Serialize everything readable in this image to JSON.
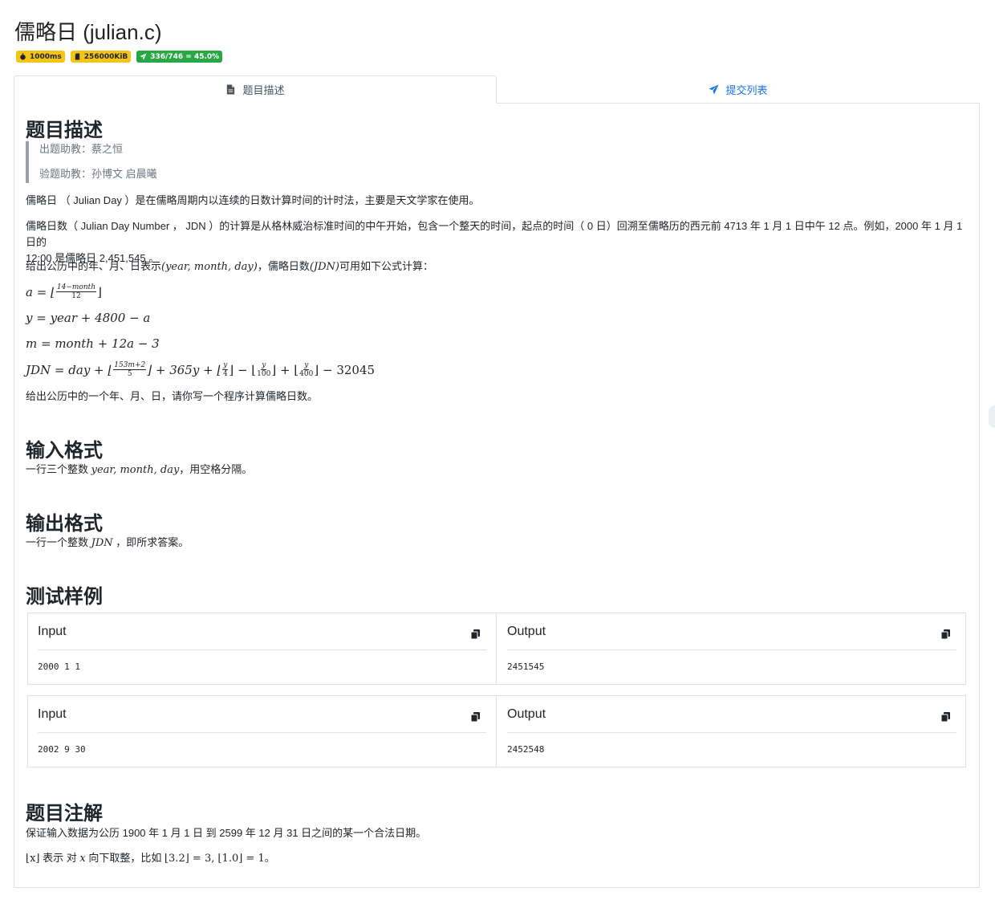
{
  "page": {
    "title": "儒略日 (julian.c)",
    "badges": [
      {
        "icon": "stopwatch-icon",
        "label": "1000ms",
        "color": "#f5c516"
      },
      {
        "icon": "sd-card-icon",
        "label": "256000KiB",
        "color": "#f5c516"
      },
      {
        "icon": "paper-plane-icon",
        "label": "336/746 = 45.0%",
        "color": "#28a745"
      }
    ]
  },
  "tabs": {
    "description": {
      "icon": "file-icon",
      "label": "题目描述"
    },
    "submissions": {
      "icon": "paper-plane-icon",
      "label": "提交列表"
    }
  },
  "problem": {
    "heading": "题目描述",
    "setter": "出题助教：蔡之恒",
    "tester": "验题助教：孙博文 启晨曦",
    "para1": "儒略日 （ Julian Day ）是在儒略周期内以连续的日数计算时间的计时法，主要是天文学家在使用。",
    "para2_line1": "儒略日数（ Julian Day Number ， JDN ）的计算是从格林威治标准时间的中午开始，包含一个整天的时间，起点的时间（ 0 日）回溯至儒略历的西元前 4713 年 1 月 1 日中午 12 点。例如，2000 年 1 月 1 日的",
    "para2_line2": "12:00 是儒略日 2,451,545 。",
    "para3_a": "给出公历中的年、月、日表示",
    "para3_math1": "(year, month, day)",
    "para3_b": "，儒略日数",
    "para3_math2": "(JDN)",
    "para3_c": "可用如下公式计算：",
    "para4": "给出公历中的一个年、月、日，请你写一个程序计算儒略日数。"
  },
  "formulas": {
    "f1_lhs": "a = ⌊",
    "f1_num": "14−month",
    "f1_den": "12",
    "f1_rhs": "⌋",
    "f2": "y = year + 4800 − a",
    "f3": "m = month + 12a − 3",
    "f4_a": "JDN = day + ⌊",
    "f4_num1": "153m+2",
    "f4_den1": "5",
    "f4_b": "⌋ + 365y + ⌊",
    "f4_num2": "y",
    "f4_den2": "4",
    "f4_c": "⌋ − ⌊",
    "f4_num3": "y",
    "f4_den3": "100",
    "f4_d": "⌋ + ⌊",
    "f4_num4": "y",
    "f4_den4": "400",
    "f4_e": "⌋ − 32045"
  },
  "input_format": {
    "heading": "输入格式",
    "text_a": "一行三个整数",
    "text_math": "year, month, day",
    "text_b": "，用空格分隔。"
  },
  "output_format": {
    "heading": "输出格式",
    "text_a": "一行一个整数",
    "text_math": "JDN",
    "text_b": "，即所求答案。"
  },
  "samples": {
    "heading": "测试样例",
    "items": [
      {
        "input_label": "Input",
        "input": "2000 1 1",
        "output_label": "Output",
        "output": "2451545"
      },
      {
        "input_label": "Input",
        "input": "2002 9 30",
        "output_label": "Output",
        "output": "2452548"
      }
    ]
  },
  "notes": {
    "heading": "题目注解",
    "line1": "保证输入数据为公历 1900 年 1 月 1 日 到 2599 年 12 月 31 日之间的某一个合法日期。",
    "line2_math1": "⌊x⌋",
    "line2_a": "表示 对",
    "line2_math2": "x",
    "line2_b": "向下取整，比如",
    "line2_math3": "⌊3.2⌋ = 3, ⌊1.0⌋ = 1",
    "line2_c": "。"
  }
}
